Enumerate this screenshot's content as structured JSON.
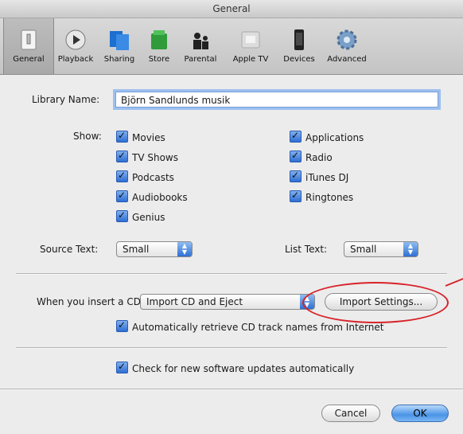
{
  "window": {
    "title": "General"
  },
  "toolbar": {
    "items": [
      {
        "label": "General",
        "icon": "general-switch-icon",
        "selected": true
      },
      {
        "label": "Playback",
        "icon": "play-icon"
      },
      {
        "label": "Sharing",
        "icon": "sharing-icon"
      },
      {
        "label": "Store",
        "icon": "store-bag-icon"
      },
      {
        "label": "Parental",
        "icon": "parental-icon"
      },
      {
        "label": "Apple TV",
        "icon": "apple-tv-icon"
      },
      {
        "label": "Devices",
        "icon": "iphone-icon"
      },
      {
        "label": "Advanced",
        "icon": "gear-icon"
      }
    ]
  },
  "library": {
    "label": "Library Name:",
    "value": "Björn Sandlunds musik"
  },
  "show": {
    "label": "Show:",
    "left": [
      "Movies",
      "TV Shows",
      "Podcasts",
      "Audiobooks",
      "Genius"
    ],
    "right": [
      "Applications",
      "Radio",
      "iTunes DJ",
      "Ringtones"
    ]
  },
  "source_text": {
    "label": "Source Text:",
    "value": "Small"
  },
  "list_text": {
    "label": "List Text:",
    "value": "Small"
  },
  "cd": {
    "label": "When you insert a CD:",
    "value": "Import CD and Eject",
    "import_settings": "Import Settings...",
    "auto_retrieve": "Automatically retrieve CD track names from Internet"
  },
  "updates": {
    "label": "Check for new software updates automatically"
  },
  "buttons": {
    "cancel": "Cancel",
    "ok": "OK"
  },
  "colors": {
    "highlight_oval": "#d8232a",
    "accent": "#2f6fd4"
  }
}
